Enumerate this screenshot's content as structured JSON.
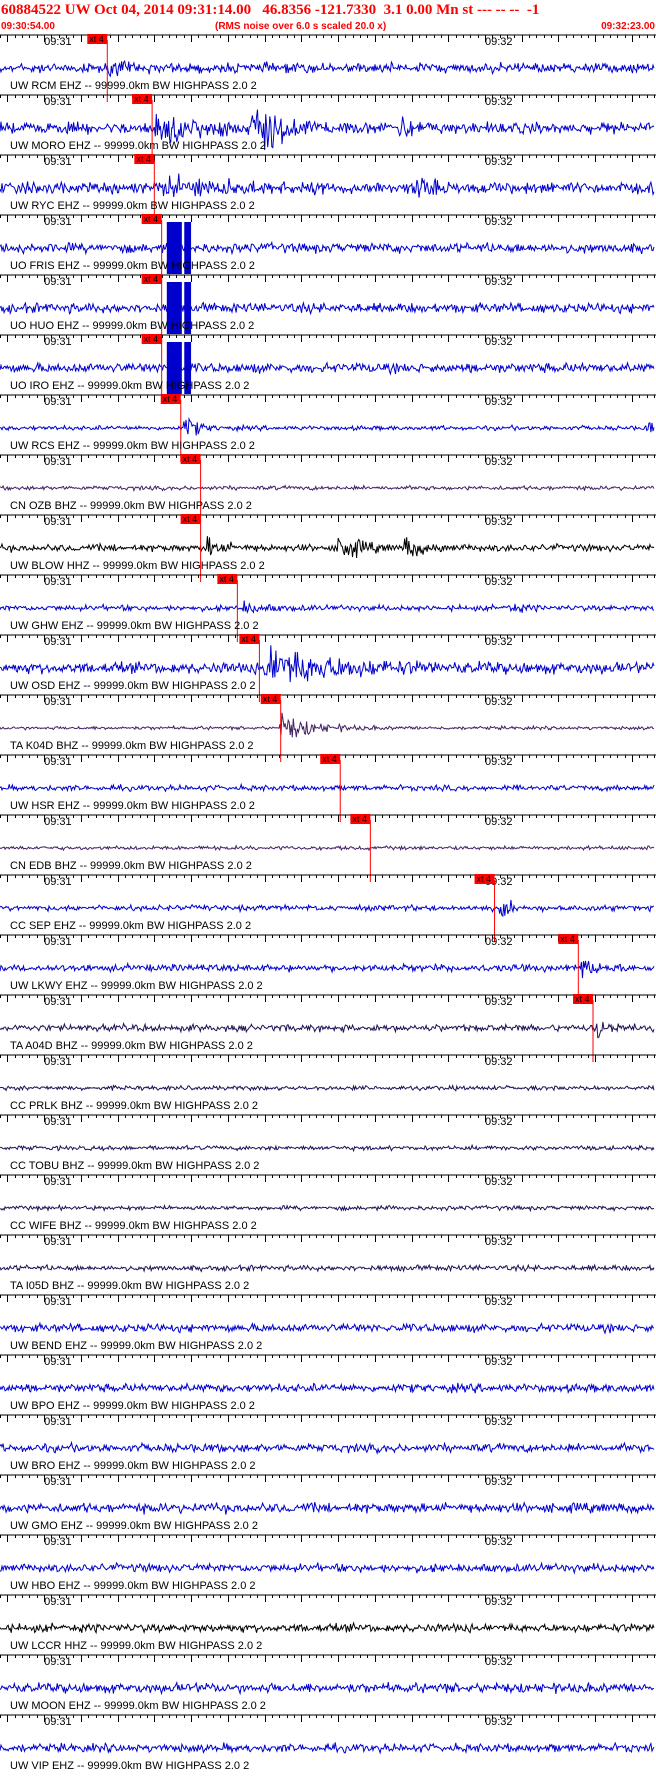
{
  "header": {
    "title": "60884522 UW Oct 04, 2014 09:31:14.00   46.8356 -121.7330  3.1 0.00 Mn st --- -- --  -1",
    "start_time": "09:30:54.00",
    "note": "(RMS noise over 6.0 s scaled 20.0 x)",
    "end_time": "09:32:23.00"
  },
  "chart_data": {
    "type": "line",
    "title": "60884522 UW Oct 04, 2014 09:31:14.00   46.8356 -121.7330  3.1 0.00 Mn st --- -- --  -1",
    "x_start": "09:30:54.00",
    "x_end": "09:32:23.00",
    "x_range_seconds": [
      0,
      89
    ],
    "minute_tick_labels": [
      "09:31",
      "09:32"
    ],
    "minute_tick_seconds": [
      6,
      66
    ],
    "pick_label": "xt 4",
    "traces": [
      {
        "label": "UW RCM EHZ -- 99999.0km BW  HIGHPASS  2.0  2",
        "color": "#0000cc",
        "pick_s": 14.6,
        "amp": 3.5,
        "bursts": [
          {
            "t": 14.8,
            "a": 1.5,
            "d": 1.5
          }
        ]
      },
      {
        "label": "UW MORO EHZ -- 99999.0km BW  HIGHPASS  2.0  2",
        "color": "#0000cc",
        "pick_s": 20.7,
        "amp": 4,
        "bursts": [
          {
            "t": 21,
            "a": 3,
            "d": 5
          },
          {
            "t": 34,
            "a": 6,
            "d": 3.5
          },
          {
            "t": 54,
            "a": 2,
            "d": 2
          }
        ]
      },
      {
        "label": "UW RYC EHZ -- 99999.0km BW  HIGHPASS  2.0  2",
        "color": "#0000cc",
        "pick_s": 21.0,
        "amp": 4,
        "bursts": [
          {
            "t": 22,
            "a": 1.6,
            "d": 8
          },
          {
            "t": 56,
            "a": 2.2,
            "d": 2
          }
        ]
      },
      {
        "label": "UO FRIS EHZ -- 99999.0km BW  HIGHPASS  2.0  2",
        "color": "#0000cc",
        "pick_s": 22.0,
        "amp": 3.5,
        "bursts": [],
        "clipped": [
          14,
          18
        ]
      },
      {
        "label": "UO HUO EHZ -- 99999.0km BW  HIGHPASS  2.0  2",
        "color": "#0000cc",
        "pick_s": 22.0,
        "amp": 3.5,
        "bursts": [],
        "clipped": [
          14,
          18
        ]
      },
      {
        "label": "UO IRO EHZ -- 99999.0km BW  HIGHPASS  2.0  2",
        "color": "#0000cc",
        "pick_s": 22.0,
        "amp": 3.5,
        "bursts": [],
        "clipped": [
          14,
          18
        ]
      },
      {
        "label": "UW RCS EHZ -- 99999.0km BW  HIGHPASS  2.0  2",
        "color": "#0000cc",
        "pick_s": 24.6,
        "amp": 1.6,
        "bursts": [
          {
            "t": 25,
            "a": 7,
            "d": 1.5
          },
          {
            "t": 88,
            "a": 6,
            "d": 0.6
          }
        ]
      },
      {
        "label": "CN OZB BHZ -- 99999.0km BW  HIGHPASS  2.0  2",
        "color": "#442266",
        "pick_s": 27.3,
        "amp": 1.5,
        "bursts": []
      },
      {
        "label": "UW BLOW HHZ -- 99999.0km BW  HIGHPASS  2.0  2",
        "color": "#000000",
        "pick_s": 27.3,
        "amp": 2.5,
        "bursts": [
          {
            "t": 28,
            "a": 3,
            "d": 2
          },
          {
            "t": 46,
            "a": 5,
            "d": 2.2
          },
          {
            "t": 55,
            "a": 3.5,
            "d": 2
          }
        ]
      },
      {
        "label": "UW GHW EHZ -- 99999.0km BW  HIGHPASS  2.0  2",
        "color": "#0000cc",
        "pick_s": 32.3,
        "amp": 2,
        "bursts": [
          {
            "t": 33,
            "a": 2,
            "d": 2.5
          },
          {
            "t": 69,
            "a": 2,
            "d": 1.5
          }
        ]
      },
      {
        "label": "UW OSD EHZ -- 99999.0km BW  HIGHPASS  2.0  2",
        "color": "#0000cc",
        "pick_s": 35.3,
        "amp": 4,
        "bursts": [
          {
            "t": 36,
            "a": 4,
            "d": 8
          }
        ]
      },
      {
        "label": "TA K04D BHZ -- 99999.0km BW  HIGHPASS  2.0  2",
        "color": "#442266",
        "pick_s": 38.2,
        "amp": 1.2,
        "bursts": [
          {
            "t": 38,
            "a": 9,
            "d": 4
          }
        ]
      },
      {
        "label": "UW HSR EHZ -- 99999.0km BW  HIGHPASS  2.0  2",
        "color": "#0000cc",
        "pick_s": 46.3,
        "amp": 2,
        "bursts": []
      },
      {
        "label": "CN EDB BHZ -- 99999.0km BW  HIGHPASS  2.0  2",
        "color": "#442266",
        "pick_s": 50.4,
        "amp": 1.4,
        "bursts": []
      },
      {
        "label": "CC SEP EHZ -- 99999.0km BW  HIGHPASS  2.0  2",
        "color": "#0000cc",
        "pick_s": 67.3,
        "amp": 2,
        "bursts": [
          {
            "t": 68,
            "a": 3.5,
            "d": 1.5
          }
        ]
      },
      {
        "label": "UW LKWY EHZ -- 99999.0km BW  HIGHPASS  2.0  2",
        "color": "#0000cc",
        "pick_s": 78.7,
        "amp": 2.5,
        "bursts": [
          {
            "t": 79,
            "a": 4,
            "d": 1.5
          }
        ]
      },
      {
        "label": "TA A04D BHZ -- 99999.0km BW  HIGHPASS  2.0  2",
        "color": "#221155",
        "pick_s": 80.7,
        "amp": 2.5,
        "bursts": [
          {
            "t": 81,
            "a": 4,
            "d": 1.5
          }
        ]
      },
      {
        "label": "CC PRLK BHZ -- 99999.0km BW  HIGHPASS  2.0  2",
        "color": "#221155",
        "pick_s": null,
        "amp": 1.6,
        "bursts": []
      },
      {
        "label": "CC TOBU BHZ -- 99999.0km BW  HIGHPASS  2.0  2",
        "color": "#221155",
        "pick_s": null,
        "amp": 1.6,
        "bursts": []
      },
      {
        "label": "CC WIFE BHZ -- 99999.0km BW  HIGHPASS  2.0  2",
        "color": "#221155",
        "pick_s": null,
        "amp": 1.6,
        "bursts": []
      },
      {
        "label": "TA I05D BHZ -- 99999.0km BW  HIGHPASS  2.0  2",
        "color": "#221155",
        "pick_s": null,
        "amp": 2,
        "bursts": []
      },
      {
        "label": "UW BEND EHZ -- 99999.0km BW  HIGHPASS  2.0  2",
        "color": "#0000cc",
        "pick_s": null,
        "amp": 3,
        "bursts": []
      },
      {
        "label": "UW BPO EHZ -- 99999.0km BW  HIGHPASS  2.0  2",
        "color": "#0000cc",
        "pick_s": null,
        "amp": 3,
        "bursts": []
      },
      {
        "label": "UW BRO EHZ -- 99999.0km BW  HIGHPASS  2.0  2",
        "color": "#0000cc",
        "pick_s": null,
        "amp": 3,
        "bursts": []
      },
      {
        "label": "UW GMO EHZ -- 99999.0km BW  HIGHPASS  2.0  2",
        "color": "#0000cc",
        "pick_s": null,
        "amp": 3.5,
        "bursts": []
      },
      {
        "label": "UW HBO EHZ -- 99999.0km BW  HIGHPASS  2.0  2",
        "color": "#0000cc",
        "pick_s": null,
        "amp": 3,
        "bursts": []
      },
      {
        "label": "UW LCCR HHZ -- 99999.0km BW  HIGHPASS  2.0  2",
        "color": "#000000",
        "pick_s": null,
        "amp": 3,
        "bursts": []
      },
      {
        "label": "UW MOON EHZ -- 99999.0km BW  HIGHPASS  2.0  2",
        "color": "#0000cc",
        "pick_s": null,
        "amp": 3.5,
        "bursts": []
      },
      {
        "label": "UW VIP EHZ -- 99999.0km BW  HIGHPASS  2.0  2",
        "color": "#0000cc",
        "pick_s": null,
        "amp": 3,
        "bursts": []
      }
    ]
  }
}
